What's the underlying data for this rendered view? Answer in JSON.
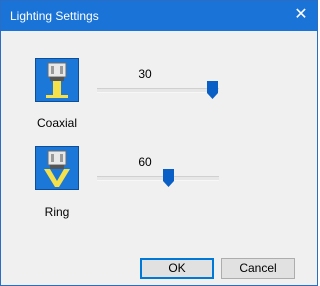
{
  "window": {
    "title": "Lighting Settings",
    "close_glyph": "✕"
  },
  "lights": [
    {
      "label": "Coaxial",
      "value": "30",
      "level_percent": 100,
      "icon": "coaxial-light-icon"
    },
    {
      "label": "Ring",
      "value": "60",
      "level_percent": 60,
      "icon": "ring-light-icon"
    }
  ],
  "buttons": {
    "ok_label": "OK",
    "cancel_label": "Cancel"
  },
  "colors": {
    "titlebar": "#1a73d6",
    "accent": "#1c78d8",
    "light_yellow": "#f4e04a",
    "thumb": "#0a5fc7"
  }
}
